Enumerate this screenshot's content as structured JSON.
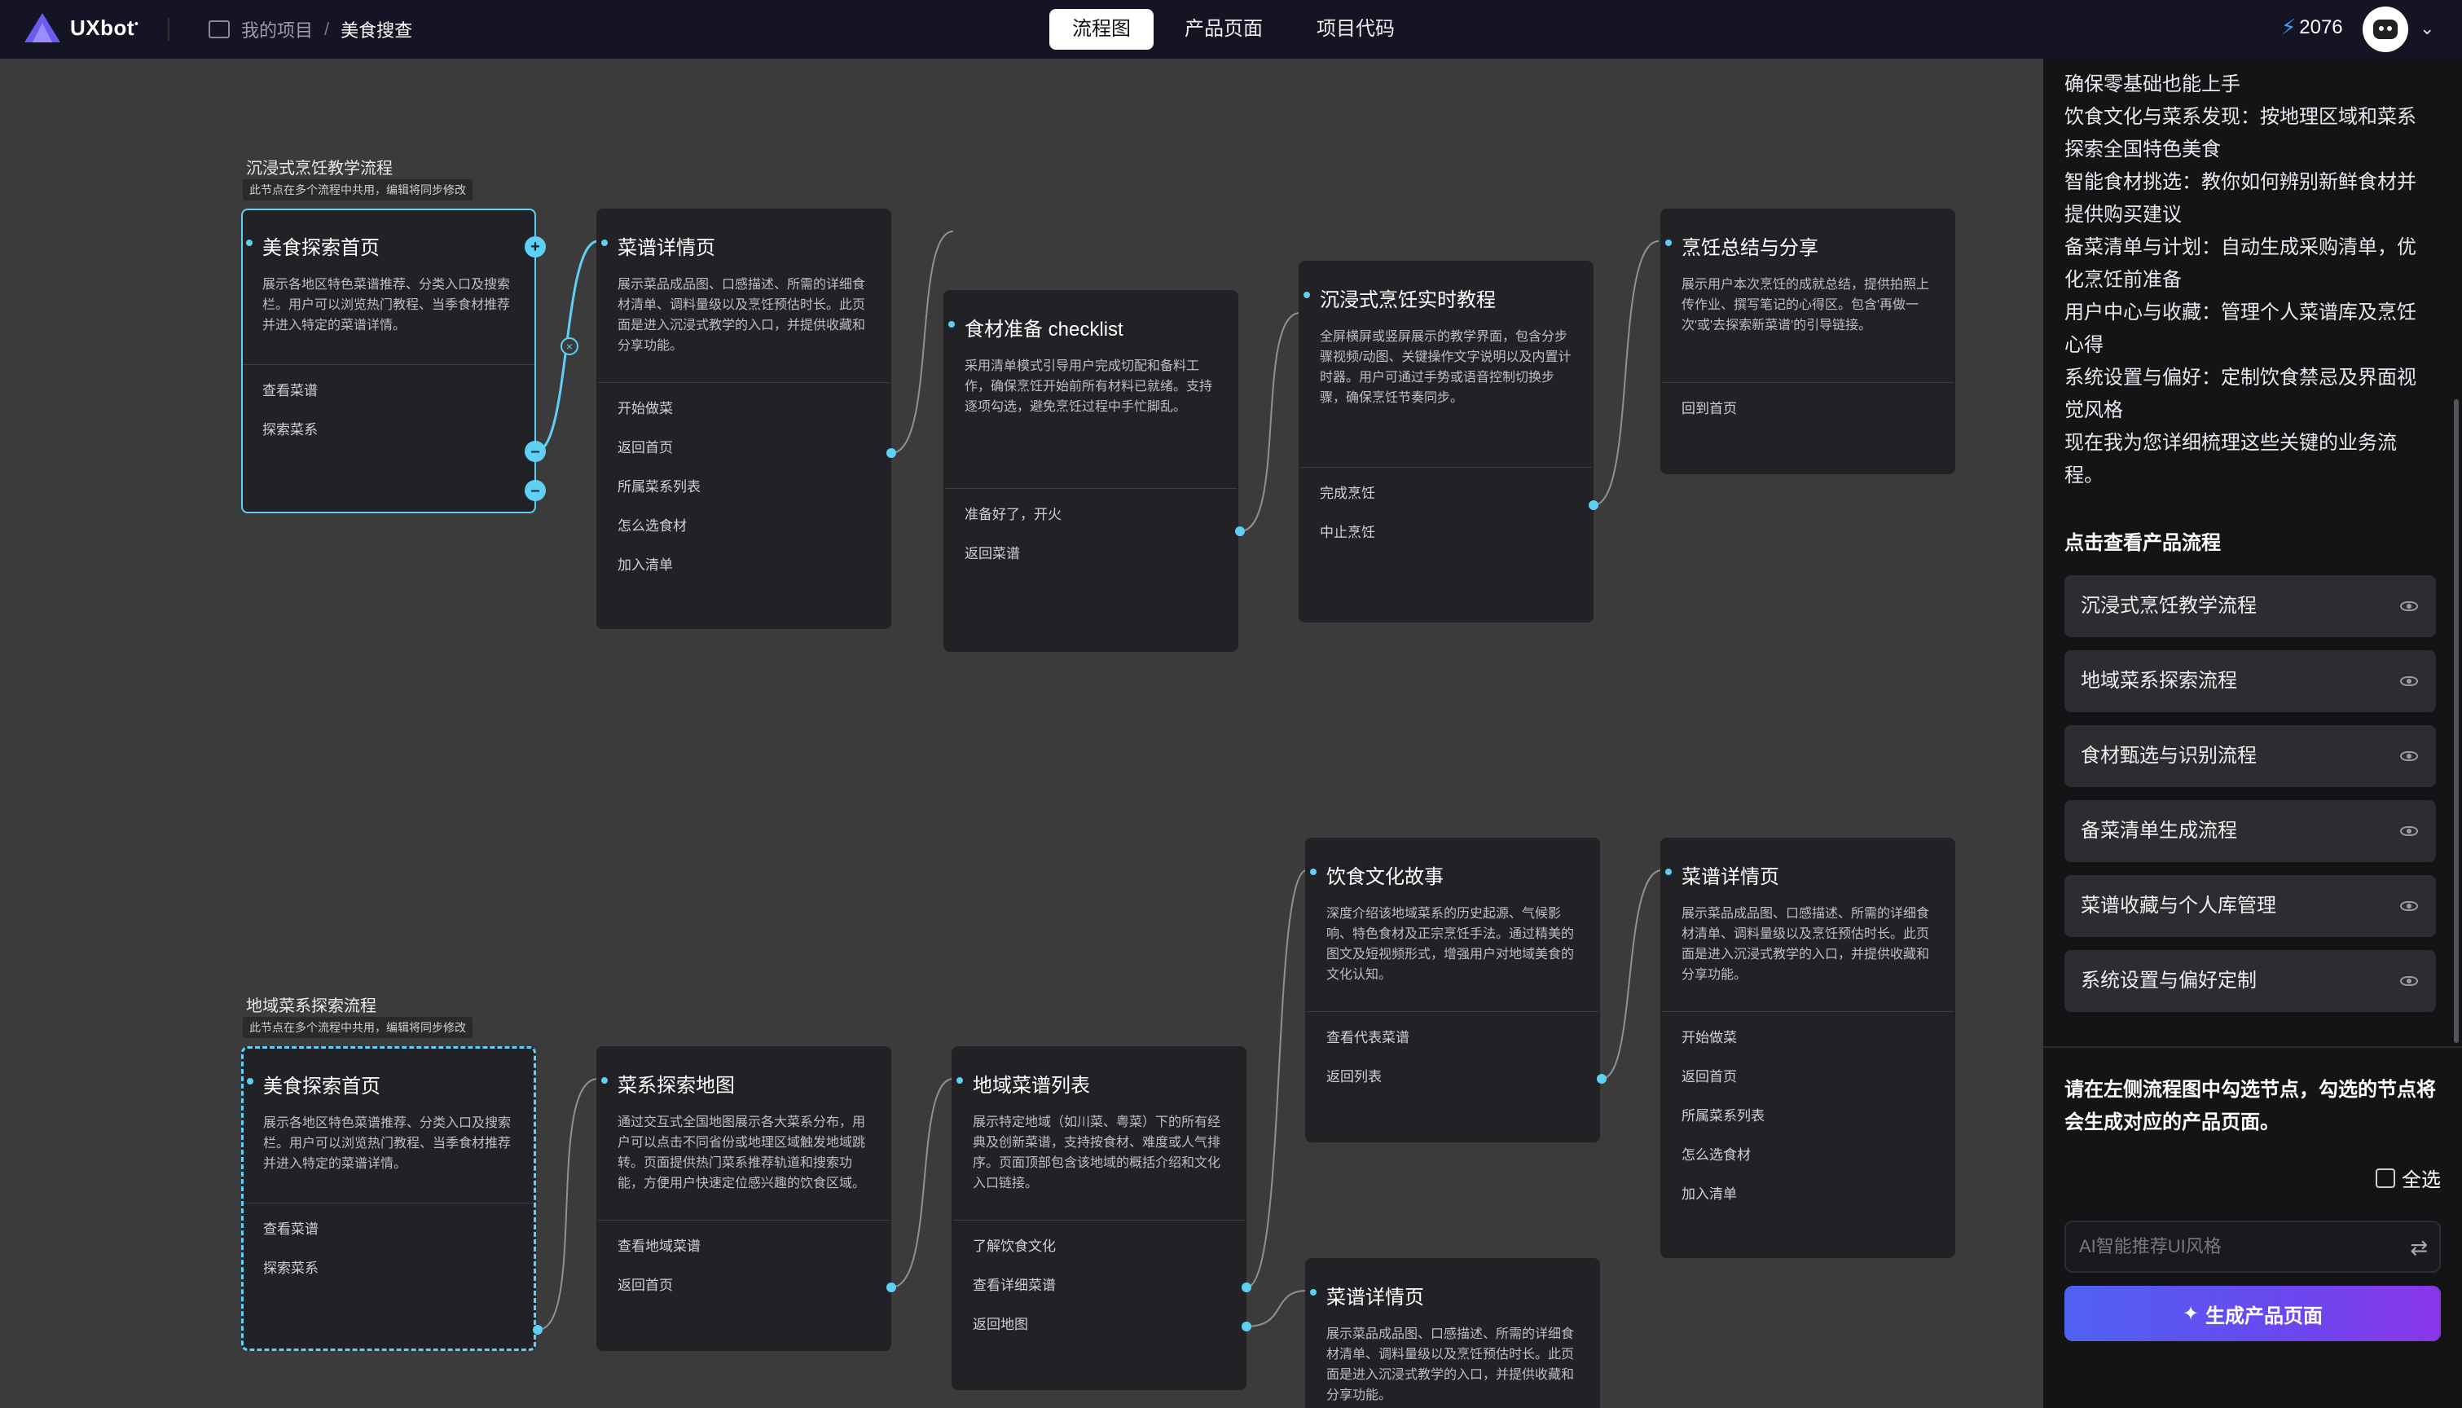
{
  "app": {
    "logo_text": "UXbot",
    "credits": "2076"
  },
  "breadcrumb": {
    "root": "我的项目",
    "separator": "/",
    "current": "美食搜查"
  },
  "tabs": [
    {
      "label": "流程图"
    },
    {
      "label": "产品页面"
    },
    {
      "label": "项目代码"
    }
  ],
  "flows": [
    {
      "title": "沉浸式烹饪教学流程",
      "shared_note": "此节点在多个流程中共用，编辑将同步修改"
    },
    {
      "title": "地域菜系探索流程",
      "shared_note": "此节点在多个流程中共用，编辑将同步修改"
    }
  ],
  "nodes": {
    "a1": {
      "title": "美食探索首页",
      "desc": "展示各地区特色菜谱推荐、分类入口及搜索栏。用户可以浏览热门教程、当季食材推荐并进入特定的菜谱详情。",
      "actions": [
        "查看菜谱",
        "探索菜系"
      ]
    },
    "a2": {
      "title": "菜谱详情页",
      "desc": "展示菜品成品图、口感描述、所需的详细食材清单、调料量级以及烹饪预估时长。此页面是进入沉浸式教学的入口，并提供收藏和分享功能。",
      "actions": [
        "开始做菜",
        "返回首页",
        "所属菜系列表",
        "怎么选食材",
        "加入清单"
      ]
    },
    "a3": {
      "title": "食材准备 checklist",
      "desc": "采用清单模式引导用户完成切配和备料工作，确保烹饪开始前所有材料已就绪。支持逐项勾选，避免烹饪过程中手忙脚乱。",
      "actions": [
        "准备好了，开火",
        "返回菜谱"
      ]
    },
    "a4": {
      "title": "沉浸式烹饪实时教程",
      "desc": "全屏横屏或竖屏展示的教学界面，包含分步骤视频/动图、关键操作文字说明以及内置计时器。用户可通过手势或语音控制切换步骤，确保烹饪节奏同步。",
      "actions": [
        "完成烹饪",
        "中止烹饪"
      ]
    },
    "a5": {
      "title": "烹饪总结与分享",
      "desc": "展示用户本次烹饪的成就总结，提供拍照上传作业、撰写笔记的心得区。包含'再做一次'或'去探索新菜谱'的引导链接。",
      "actions": [
        "回到首页"
      ]
    },
    "b1": {
      "title": "美食探索首页",
      "desc": "展示各地区特色菜谱推荐、分类入口及搜索栏。用户可以浏览热门教程、当季食材推荐并进入特定的菜谱详情。",
      "actions": [
        "查看菜谱",
        "探索菜系"
      ]
    },
    "b2": {
      "title": "菜系探索地图",
      "desc": "通过交互式全国地图展示各大菜系分布，用户可以点击不同省份或地理区域触发地域跳转。页面提供热门菜系推荐轨道和搜索功能，方便用户快速定位感兴趣的饮食区域。",
      "actions": [
        "查看地域菜谱",
        "返回首页"
      ]
    },
    "b3": {
      "title": "地域菜谱列表",
      "desc": "展示特定地域（如川菜、粤菜）下的所有经典及创新菜谱，支持按食材、难度或人气排序。页面顶部包含该地域的概括介绍和文化入口链接。",
      "actions": [
        "了解饮食文化",
        "查看详细菜谱",
        "返回地图"
      ]
    },
    "b4": {
      "title": "饮食文化故事",
      "desc": "深度介绍该地域菜系的历史起源、气候影响、特色食材及正宗烹饪手法。通过精美的图文及短视频形式，增强用户对地域美食的文化认知。",
      "actions": [
        "查看代表菜谱",
        "返回列表"
      ]
    },
    "b5": {
      "title": "菜谱详情页",
      "desc": "展示菜品成品图、口感描述、所需的详细食材清单、调料量级以及烹饪预估时长。此页面是进入沉浸式教学的入口，并提供收藏和分享功能。",
      "actions": [
        "开始做菜",
        "返回首页",
        "所属菜系列表",
        "怎么选食材",
        "加入清单"
      ]
    },
    "b6": {
      "title": "菜谱详情页",
      "desc": "展示菜品成品图、口感描述、所需的详细食材清单、调料量级以及烹饪预估时长。此页面是进入沉浸式教学的入口，并提供收藏和分享功能。",
      "actions": []
    }
  },
  "panel": {
    "intro_lines": [
      "确保零基础也能上手",
      "饮食文化与菜系发现：按地理区域和菜系探索全国特色美食",
      "智能食材挑选：教你如何辨别新鲜食材并提供购买建议",
      "备菜清单与计划：自动生成采购清单，优化烹饪前准备",
      "用户中心与收藏：管理个人菜谱库及烹饪心得",
      "系统设置与偏好：定制饮食禁忌及界面视觉风格",
      "现在我为您详细梳理这些关键的业务流程。"
    ],
    "section_title": "点击查看产品流程",
    "flow_items": [
      {
        "label": "沉浸式烹饪教学流程"
      },
      {
        "label": "地域菜系探索流程"
      },
      {
        "label": "食材甄选与识别流程"
      },
      {
        "label": "备菜清单生成流程"
      },
      {
        "label": "菜谱收藏与个人库管理"
      },
      {
        "label": "系统设置与偏好定制"
      }
    ],
    "instruction": "请在左侧流程图中勾选节点，勾选的节点将会生成对应的产品页面。",
    "select_all": "全选",
    "ai_placeholder": "AI智能推荐UI风格",
    "generate_label": "生成产品页面"
  }
}
